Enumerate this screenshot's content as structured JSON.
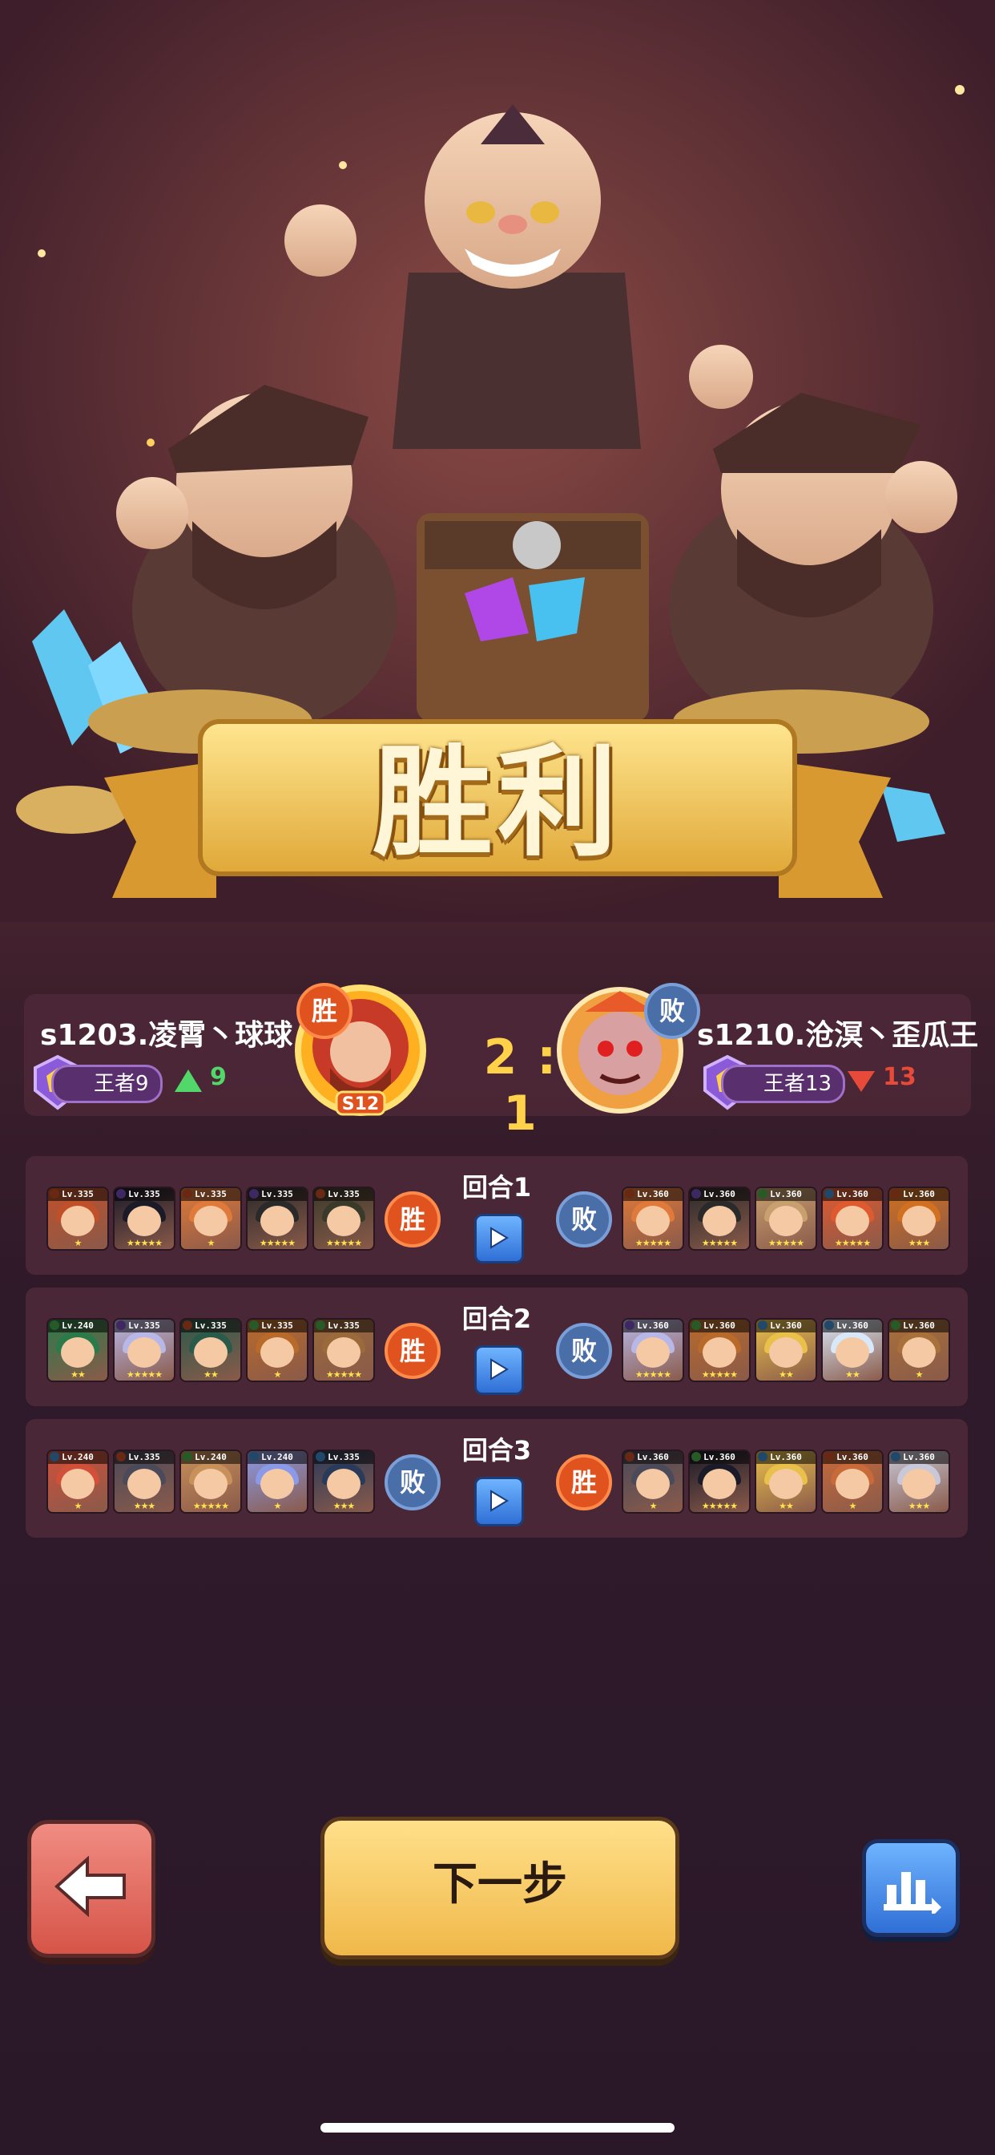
{
  "banner": {
    "title": "胜利"
  },
  "match": {
    "score": "2 : 1",
    "left": {
      "name": "s1203.凌霄丶球球",
      "rank": "王者9",
      "delta": "9",
      "result": "胜",
      "server_badge": "S12"
    },
    "right": {
      "name": "s1210.沧溟丶歪瓜王",
      "rank": "王者13",
      "delta": "13",
      "result": "败"
    }
  },
  "rounds": [
    {
      "label": "回合1",
      "left_result": "胜",
      "right_result": "败",
      "left_heroes": [
        {
          "lv": "Lv.335",
          "stars": "★",
          "el": "#e85a2a",
          "hair": "#c0502a"
        },
        {
          "lv": "Lv.335",
          "stars": "★★★★★",
          "el": "#8a5ad8",
          "hair": "#1a1a28"
        },
        {
          "lv": "Lv.335",
          "stars": "★",
          "el": "#e85a2a",
          "hair": "#e07a3a"
        },
        {
          "lv": "Lv.335",
          "stars": "★★★★★",
          "el": "#8a5ad8",
          "hair": "#2a2a2a"
        },
        {
          "lv": "Lv.335",
          "stars": "★★★★★",
          "el": "#e85a2a",
          "hair": "#3a3a2a"
        }
      ],
      "right_heroes": [
        {
          "lv": "Lv.360",
          "stars": "★★★★★",
          "el": "#e85a2a",
          "hair": "#e07a3a"
        },
        {
          "lv": "Lv.360",
          "stars": "★★★★★",
          "el": "#8a5ad8",
          "hair": "#2a2a2a"
        },
        {
          "lv": "Lv.360",
          "stars": "★★★★★",
          "el": "#5ac85a",
          "hair": "#c8a070"
        },
        {
          "lv": "Lv.360",
          "stars": "★★★★★",
          "el": "#4aa0e8",
          "hair": "#e05a30"
        },
        {
          "lv": "Lv.360",
          "stars": "★★★",
          "el": "#e85a2a",
          "hair": "#d07020"
        }
      ]
    },
    {
      "label": "回合2",
      "left_result": "胜",
      "right_result": "败",
      "left_heroes": [
        {
          "lv": "Lv.240",
          "stars": "★★",
          "el": "#5ac85a",
          "hair": "#2a7a4a"
        },
        {
          "lv": "Lv.335",
          "stars": "★★★★★",
          "el": "#8a5ad8",
          "hair": "#b8b8e8"
        },
        {
          "lv": "Lv.335",
          "stars": "★★",
          "el": "#e85a2a",
          "hair": "#2a5a4a"
        },
        {
          "lv": "Lv.335",
          "stars": "★",
          "el": "#5ac85a",
          "hair": "#b86a2a"
        },
        {
          "lv": "Lv.335",
          "stars": "★★★★★",
          "el": "#5ac85a",
          "hair": "#9a6a3a"
        }
      ],
      "right_heroes": [
        {
          "lv": "Lv.360",
          "stars": "★★★★★",
          "el": "#8a5ad8",
          "hair": "#b8b8e8"
        },
        {
          "lv": "Lv.360",
          "stars": "★★★★★",
          "el": "#5ac85a",
          "hair": "#b86a2a"
        },
        {
          "lv": "Lv.360",
          "stars": "★★",
          "el": "#4aa0e8",
          "hair": "#e8c04a"
        },
        {
          "lv": "Lv.360",
          "stars": "★★",
          "el": "#4aa0e8",
          "hair": "#d8e8f8"
        },
        {
          "lv": "Lv.360",
          "stars": "★",
          "el": "#5ac85a",
          "hair": "#a8703a"
        }
      ]
    },
    {
      "label": "回合3",
      "left_result": "败",
      "right_result": "胜",
      "left_heroes": [
        {
          "lv": "Lv.240",
          "stars": "★",
          "el": "#4aa0e8",
          "hair": "#d0503a"
        },
        {
          "lv": "Lv.335",
          "stars": "★★★",
          "el": "#e85a2a",
          "hair": "#4a4a5a"
        },
        {
          "lv": "Lv.240",
          "stars": "★★★★★",
          "el": "#5ac85a",
          "hair": "#c8905a"
        },
        {
          "lv": "Lv.240",
          "stars": "★",
          "el": "#4aa0e8",
          "hair": "#8a9ae8"
        },
        {
          "lv": "Lv.335",
          "stars": "★★★",
          "el": "#4aa0e8",
          "hair": "#2a3a5a"
        }
      ],
      "right_heroes": [
        {
          "lv": "Lv.360",
          "stars": "★",
          "el": "#e85a2a",
          "hair": "#4a4a5a"
        },
        {
          "lv": "Lv.360",
          "stars": "★★★★★",
          "el": "#5ac85a",
          "hair": "#1a1a28"
        },
        {
          "lv": "Lv.360",
          "stars": "★★",
          "el": "#4aa0e8",
          "hair": "#e8c04a"
        },
        {
          "lv": "Lv.360",
          "stars": "★",
          "el": "#e85a2a",
          "hair": "#c86a3a"
        },
        {
          "lv": "Lv.360",
          "stars": "★★★",
          "el": "#4aa0e8",
          "hair": "#c8c8d8"
        }
      ]
    }
  ],
  "buttons": {
    "back_icon": "arrow-left-icon",
    "next_label": "下一步",
    "stats_icon": "bar-chart-icon"
  },
  "colors": {
    "win": "#e0521e",
    "lose": "#4a6ea8",
    "gold": "#ffd24a"
  }
}
